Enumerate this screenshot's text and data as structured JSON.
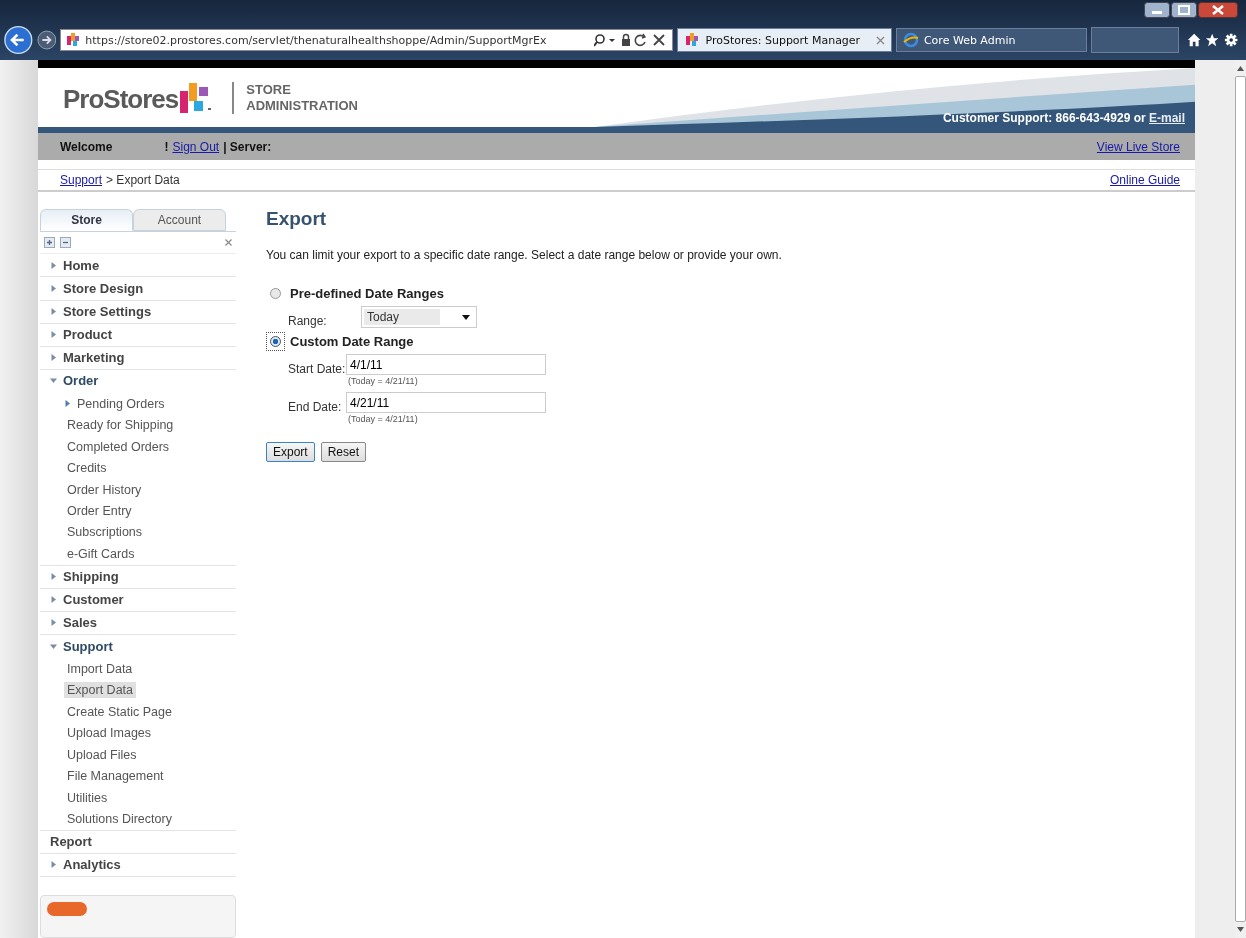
{
  "browser": {
    "address": "https://store02.prostores.com/servlet/thenaturalhealthshoppe/Admin/SupportMgrEx",
    "tabs": [
      {
        "label": "ProStores: Support Manager",
        "selected": true
      },
      {
        "label": "Core Web Admin",
        "selected": false
      }
    ]
  },
  "header": {
    "logo": "ProStores",
    "subtitle": [
      "STORE",
      "ADMINISTRATION"
    ],
    "support_text": "Customer Support: 866-643-4929 or",
    "support_link": "E-mail"
  },
  "welcome_bar": {
    "welcome": "Welcome",
    "mark": "!",
    "sign_out": "Sign Out",
    "server": "| Server:",
    "view_store": "View Live Store"
  },
  "breadcrumb": {
    "link": "Support",
    "current": "> Export Data",
    "guide": "Online Guide"
  },
  "sidebar": {
    "tabs": [
      {
        "label": "Store",
        "selected": true
      },
      {
        "label": "Account",
        "selected": false
      }
    ],
    "items": [
      {
        "label": "Home",
        "kind": "group",
        "expanded": false
      },
      {
        "label": "Store Design",
        "kind": "group",
        "expanded": false
      },
      {
        "label": "Store Settings",
        "kind": "group",
        "expanded": false
      },
      {
        "label": "Product",
        "kind": "group",
        "expanded": false
      },
      {
        "label": "Marketing",
        "kind": "group",
        "expanded": false
      },
      {
        "label": "Order",
        "kind": "group",
        "expanded": true,
        "children": [
          {
            "label": "Pending Orders",
            "kind": "group",
            "selected": false
          },
          {
            "label": "Ready for Shipping",
            "kind": "leaf",
            "selected": false
          },
          {
            "label": "Completed Orders",
            "kind": "leaf",
            "selected": false
          },
          {
            "label": "Credits",
            "kind": "leaf",
            "selected": false
          },
          {
            "label": "Order History",
            "kind": "leaf",
            "selected": false
          },
          {
            "label": "Order Entry",
            "kind": "leaf",
            "selected": false
          },
          {
            "label": "Subscriptions",
            "kind": "leaf",
            "selected": false
          },
          {
            "label": "e-Gift Cards",
            "kind": "leaf",
            "selected": false
          }
        ]
      },
      {
        "label": "Shipping",
        "kind": "group",
        "expanded": false
      },
      {
        "label": "Customer",
        "kind": "group",
        "expanded": false
      },
      {
        "label": "Sales",
        "kind": "group",
        "expanded": false
      },
      {
        "label": "Support",
        "kind": "group",
        "expanded": true,
        "children": [
          {
            "label": "Import Data",
            "kind": "leaf",
            "selected": false
          },
          {
            "label": "Export Data",
            "kind": "leaf",
            "selected": true
          },
          {
            "label": "Create Static Page",
            "kind": "leaf",
            "selected": false
          },
          {
            "label": "Upload Images",
            "kind": "leaf",
            "selected": false
          },
          {
            "label": "Upload Files",
            "kind": "leaf",
            "selected": false
          },
          {
            "label": "File Management",
            "kind": "leaf",
            "selected": false
          },
          {
            "label": "Utilities",
            "kind": "leaf",
            "selected": false
          },
          {
            "label": "Solutions Directory",
            "kind": "leaf",
            "selected": false
          }
        ]
      },
      {
        "label": "Report",
        "kind": "plain",
        "expanded": false
      },
      {
        "label": "Analytics",
        "kind": "group",
        "expanded": false
      }
    ]
  },
  "main": {
    "title": "Export",
    "intro": "You can limit your export to a specific date range. Select a date range below or provide your own.",
    "options": [
      {
        "label": "Pre-defined Date Ranges",
        "selected": false,
        "fields": [
          {
            "kind": "select",
            "label": "Range:",
            "value": "Today"
          }
        ]
      },
      {
        "label": "Custom Date Range",
        "selected": true,
        "fields": [
          {
            "kind": "date",
            "label": "Start Date:",
            "value": "4/1/11",
            "note": "(Today = 4/21/11)"
          },
          {
            "kind": "date",
            "label": "End Date:",
            "value": "4/21/11",
            "note": "(Today = 4/21/11)"
          }
        ]
      }
    ],
    "buttons": [
      {
        "label": "Export",
        "kind": "primary"
      },
      {
        "label": "Reset",
        "kind": "secondary"
      }
    ]
  }
}
